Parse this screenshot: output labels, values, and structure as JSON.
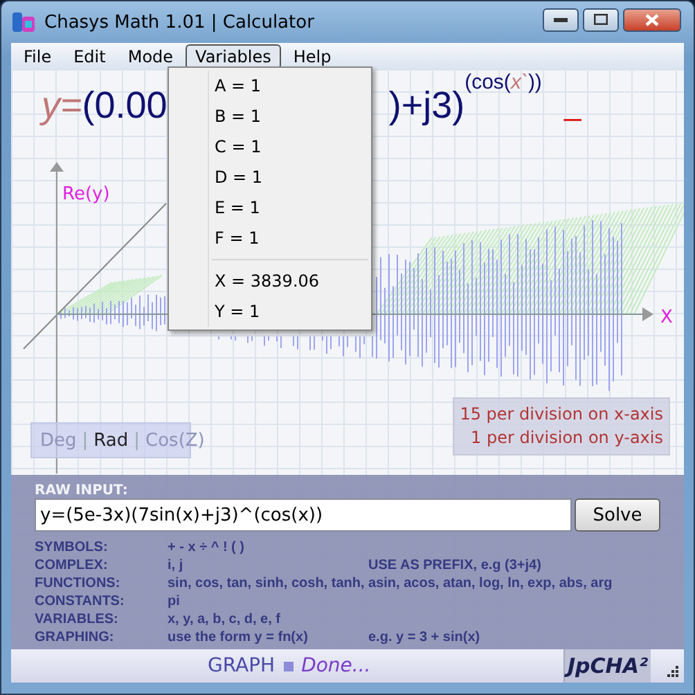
{
  "window": {
    "title": "Chasys Math 1.01 | Calculator"
  },
  "menu": [
    {
      "label": "File",
      "selected": false
    },
    {
      "label": "Edit",
      "selected": false
    },
    {
      "label": "Mode",
      "selected": false
    },
    {
      "label": "Variables",
      "selected": true
    },
    {
      "label": "Help",
      "selected": false
    }
  ],
  "variables_menu": [
    {
      "kind": "item",
      "label": "A = 1"
    },
    {
      "kind": "item",
      "label": "B = 1"
    },
    {
      "kind": "item",
      "label": "C = 1"
    },
    {
      "kind": "item",
      "label": "D = 1"
    },
    {
      "kind": "item",
      "label": "E = 1"
    },
    {
      "kind": "item",
      "label": "F = 1"
    },
    {
      "kind": "separator"
    },
    {
      "kind": "item",
      "label": "X = 3839.06"
    },
    {
      "kind": "item",
      "label": "Y = 1"
    }
  ],
  "equation": {
    "left": [
      {
        "kind": "var",
        "text": "y="
      },
      {
        "kind": "num",
        "text": "(0.00"
      }
    ],
    "right": [
      {
        "kind": "num",
        "text": ")+j3)"
      }
    ],
    "exponent": [
      {
        "kind": "num",
        "text": "(cos("
      },
      {
        "kind": "var",
        "text": "x`"
      },
      {
        "kind": "num",
        "text": "))"
      }
    ],
    "cursor": "_"
  },
  "graph": {
    "y_label": "Re(y)",
    "x_label": "X",
    "separator": "|",
    "angle_modes": [
      {
        "label": "Deg",
        "selected": false
      },
      {
        "label": "Rad",
        "selected": true
      },
      {
        "label": "Cos(Z)",
        "selected": false
      }
    ],
    "scale": [
      "15 per division on x-axis",
      "1 per division on y-axis"
    ]
  },
  "input": {
    "label": "RAW INPUT:",
    "value": "y=(5e-3x)(7sin(x)+j3)^(cos(x))",
    "button": "Solve"
  },
  "help": [
    {
      "label": "SYMBOLS:",
      "value": "+ - x ÷ ^ ! ( )"
    },
    {
      "label": "COMPLEX:",
      "value": "i, j",
      "note": "USE AS PREFIX, e.g (3+j4)"
    },
    {
      "label": "FUNCTIONS:",
      "value": "sin, cos, tan, sinh, cosh, tanh, asin, acos, atan, log, ln, exp, abs, arg"
    },
    {
      "label": "CONSTANTS:",
      "value": "pi"
    },
    {
      "label": "VARIABLES:",
      "value": "x, y, a, b, c, d, e, f"
    },
    {
      "label": "GRAPHING:",
      "value": "use the form y = fn(x)",
      "note": "e.g. y = 3 + sin(x)"
    }
  ],
  "status": {
    "mode": "GRAPH",
    "message": "Done...",
    "logo": "JpCHA²"
  }
}
